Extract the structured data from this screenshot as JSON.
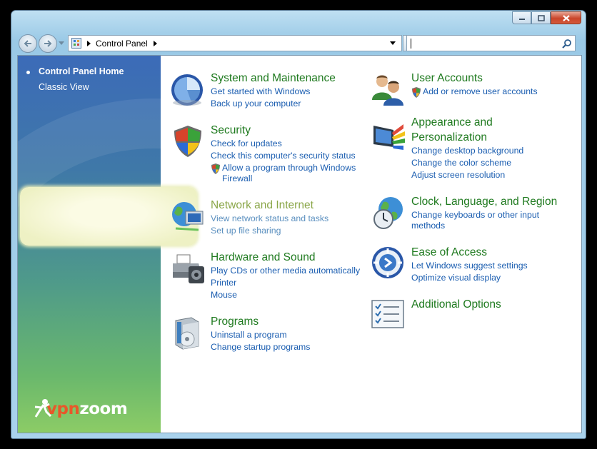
{
  "window": {
    "controls": {
      "minimize_icon": "minimize-icon",
      "maximize_icon": "maximize-icon",
      "close_icon": "close-icon"
    }
  },
  "address": {
    "breadcrumb_root": "Control Panel",
    "search_placeholder": ""
  },
  "sidebar": {
    "items": [
      {
        "label": "Control Panel Home",
        "active": true
      },
      {
        "label": "Classic View",
        "active": false
      }
    ],
    "watermark": {
      "left": "vpn",
      "right": "zoom"
    }
  },
  "categories": {
    "system": {
      "title": "System and Maintenance",
      "links": [
        "Get started with Windows",
        "Back up your computer"
      ]
    },
    "security": {
      "title": "Security",
      "links": [
        "Check for updates",
        "Check this computer's security status",
        "Allow a program through Windows",
        "Firewall"
      ]
    },
    "network": {
      "title": "Network and Internet",
      "links": [
        "View network status and tasks",
        "Set up file sharing"
      ]
    },
    "hardware": {
      "title": "Hardware and Sound",
      "links": [
        "Play CDs or other media automatically",
        "Printer",
        "Mouse"
      ]
    },
    "programs": {
      "title": "Programs",
      "links": [
        "Uninstall a program",
        "Change startup programs"
      ]
    },
    "users": {
      "title": "User Accounts",
      "links": [
        "Add or remove user accounts"
      ]
    },
    "appearance": {
      "title_line1": "Appearance and",
      "title_line2": "Personalization",
      "links": [
        "Change desktop background",
        "Change the color scheme",
        "Adjust screen resolution"
      ]
    },
    "clock": {
      "title": "Clock, Language, and Region",
      "links": [
        "Change keyboards or other input",
        "methods"
      ]
    },
    "ease": {
      "title": "Ease of Access",
      "links": [
        "Let Windows suggest settings",
        "Optimize visual display"
      ]
    },
    "additional": {
      "title": "Additional Options"
    }
  },
  "colors": {
    "category_title": "#1f7a1f",
    "link": "#1a5db0",
    "sidebar_top": "#3c6bb8",
    "sidebar_bottom": "#8ccc66"
  }
}
